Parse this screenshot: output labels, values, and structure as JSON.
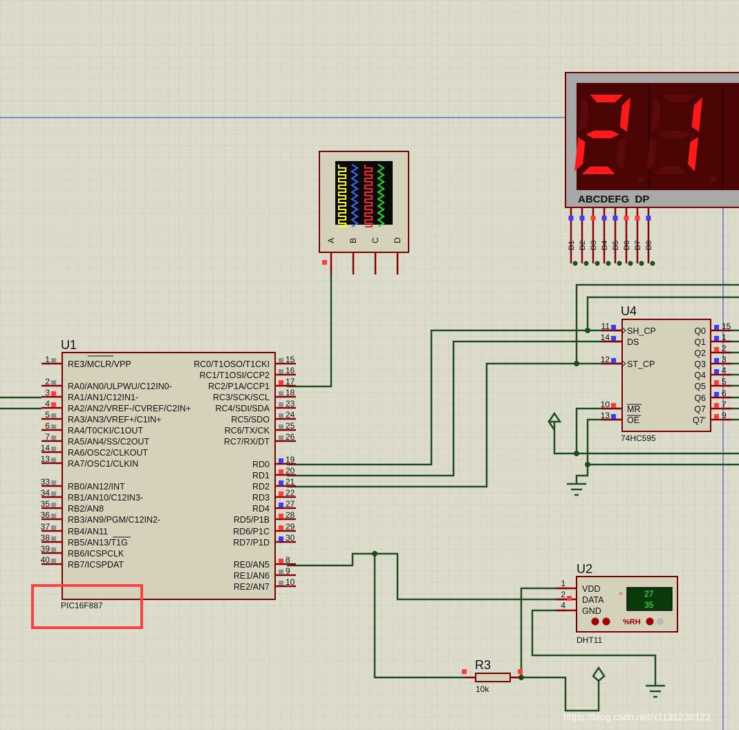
{
  "colors": {
    "background": "#dcdccc",
    "grid": "#c6c6b2",
    "wire": "#1f4d1f",
    "pin": "#8b0000",
    "component_fill": "#d4d2bb",
    "component_border": "#7a0000",
    "pin_red": "#ff3c3c",
    "pin_blue": "#3c3cff",
    "pin_gray": "#909090",
    "segment_on": "#ff1a1a",
    "segment_off": "#5a0a0a",
    "highlight": "#ff4040",
    "guide": "#3333aa"
  },
  "u1": {
    "ref": "U1",
    "part": "PIC16F887",
    "left_pins": [
      {
        "num": "1",
        "label": "RE3/MCLR/VPP",
        "state": "gray"
      },
      {
        "num": "2",
        "label": "RA0/AN0/ULPWU/C12IN0-",
        "state": "gray"
      },
      {
        "num": "3",
        "label": "RA1/AN1/C12IN1-",
        "state": "red"
      },
      {
        "num": "4",
        "label": "RA2/AN2/VREF-/CVREF/C2IN+",
        "state": "red"
      },
      {
        "num": "5",
        "label": "RA3/AN3/VREF+/C1IN+",
        "state": "gray"
      },
      {
        "num": "6",
        "label": "RA4/T0CKI/C1OUT",
        "state": "gray"
      },
      {
        "num": "7",
        "label": "RA5/AN4/SS/C2OUT",
        "state": "gray"
      },
      {
        "num": "14",
        "label": "RA6/OSC2/CLKOUT",
        "state": "gray"
      },
      {
        "num": "13",
        "label": "RA7/OSC1/CLKIN",
        "state": "gray"
      },
      {
        "num": "33",
        "label": "RB0/AN12/INT",
        "state": "gray"
      },
      {
        "num": "34",
        "label": "RB1/AN10/C12IN3-",
        "state": "gray"
      },
      {
        "num": "35",
        "label": "RB2/AN8",
        "state": "gray"
      },
      {
        "num": "36",
        "label": "RB3/AN9/PGM/C12IN2-",
        "state": "gray"
      },
      {
        "num": "37",
        "label": "RB4/AN11",
        "state": "gray"
      },
      {
        "num": "38",
        "label": "RB5/AN13/T1G",
        "state": "gray"
      },
      {
        "num": "39",
        "label": "RB6/ICSPCLK",
        "state": "gray"
      },
      {
        "num": "40",
        "label": "RB7/ICSPDAT",
        "state": "gray"
      }
    ],
    "right_pins": [
      {
        "num": "15",
        "label": "RC0/T1OSO/T1CKI",
        "state": "gray"
      },
      {
        "num": "16",
        "label": "RC1/T1OSI/CCP2",
        "state": "gray"
      },
      {
        "num": "17",
        "label": "RC2/P1A/CCP1",
        "state": "red"
      },
      {
        "num": "18",
        "label": "RC3/SCK/SCL",
        "state": "gray"
      },
      {
        "num": "23",
        "label": "RC4/SDI/SDA",
        "state": "gray"
      },
      {
        "num": "24",
        "label": "RC5/SDO",
        "state": "gray"
      },
      {
        "num": "25",
        "label": "RC6/TX/CK",
        "state": "gray"
      },
      {
        "num": "26",
        "label": "RC7/RX/DT",
        "state": "gray"
      },
      {
        "num": "19",
        "label": "RD0",
        "state": "blue"
      },
      {
        "num": "20",
        "label": "RD1",
        "state": "red"
      },
      {
        "num": "21",
        "label": "RD2",
        "state": "blue"
      },
      {
        "num": "22",
        "label": "RD3",
        "state": "red"
      },
      {
        "num": "27",
        "label": "RD4",
        "state": "blue"
      },
      {
        "num": "28",
        "label": "RD5/P1B",
        "state": "red"
      },
      {
        "num": "29",
        "label": "RD6/P1C",
        "state": "red"
      },
      {
        "num": "30",
        "label": "RD7/P1D",
        "state": "blue"
      },
      {
        "num": "8",
        "label": "RE0/AN5",
        "state": "red"
      },
      {
        "num": "9",
        "label": "RE1/AN6",
        "state": "gray"
      },
      {
        "num": "10",
        "label": "RE2/AN7",
        "state": "gray"
      }
    ]
  },
  "u4": {
    "ref": "U4",
    "part": "74HC595",
    "left_pins": [
      {
        "num": "11",
        "label": "SH_CP",
        "state": "blue"
      },
      {
        "num": "14",
        "label": "DS",
        "state": "blue"
      },
      {
        "num": "12",
        "label": "ST_CP",
        "state": "blue"
      },
      {
        "num": "10",
        "label": "MR",
        "state": "red"
      },
      {
        "num": "13",
        "label": "OE",
        "state": "blue"
      }
    ],
    "right_pins": [
      {
        "num": "15",
        "label": "Q0",
        "state": "blue"
      },
      {
        "num": "1",
        "label": "Q1",
        "state": "blue"
      },
      {
        "num": "2",
        "label": "Q2",
        "state": "red"
      },
      {
        "num": "3",
        "label": "Q3",
        "state": "blue"
      },
      {
        "num": "4",
        "label": "Q4",
        "state": "blue"
      },
      {
        "num": "5",
        "label": "Q5",
        "state": "red"
      },
      {
        "num": "6",
        "label": "Q6",
        "state": "blue"
      },
      {
        "num": "7",
        "label": "Q7",
        "state": "red"
      },
      {
        "num": "9",
        "label": "Q7'",
        "state": "red"
      }
    ]
  },
  "u2": {
    "ref": "U2",
    "part": "DHT11",
    "pins": [
      {
        "num": "1",
        "label": "VDD"
      },
      {
        "num": "2",
        "label": "DATA"
      },
      {
        "num": "4",
        "label": "GND"
      }
    ],
    "temperature": "27",
    "humidity": "35",
    "rh_label": "%RH",
    "arrow": ">"
  },
  "r3": {
    "ref": "R3",
    "value": "10k"
  },
  "display": {
    "digits": [
      "2",
      "1"
    ],
    "segment_header": "ABCDEFG  DP",
    "pins": [
      "D1",
      "D2",
      "D3",
      "D4",
      "D5",
      "D6",
      "D7",
      "D8"
    ],
    "pin_states": [
      "blue",
      "blue",
      "red",
      "blue",
      "blue",
      "red",
      "red",
      "blue"
    ]
  },
  "logic_probe": {
    "channels": [
      "A",
      "B",
      "C",
      "D"
    ],
    "trace_colors": [
      "#ffff00",
      "#3c6cff",
      "#ff2020",
      "#20e020"
    ]
  },
  "watermark": "https://blog.csdn.net/x1131230123"
}
